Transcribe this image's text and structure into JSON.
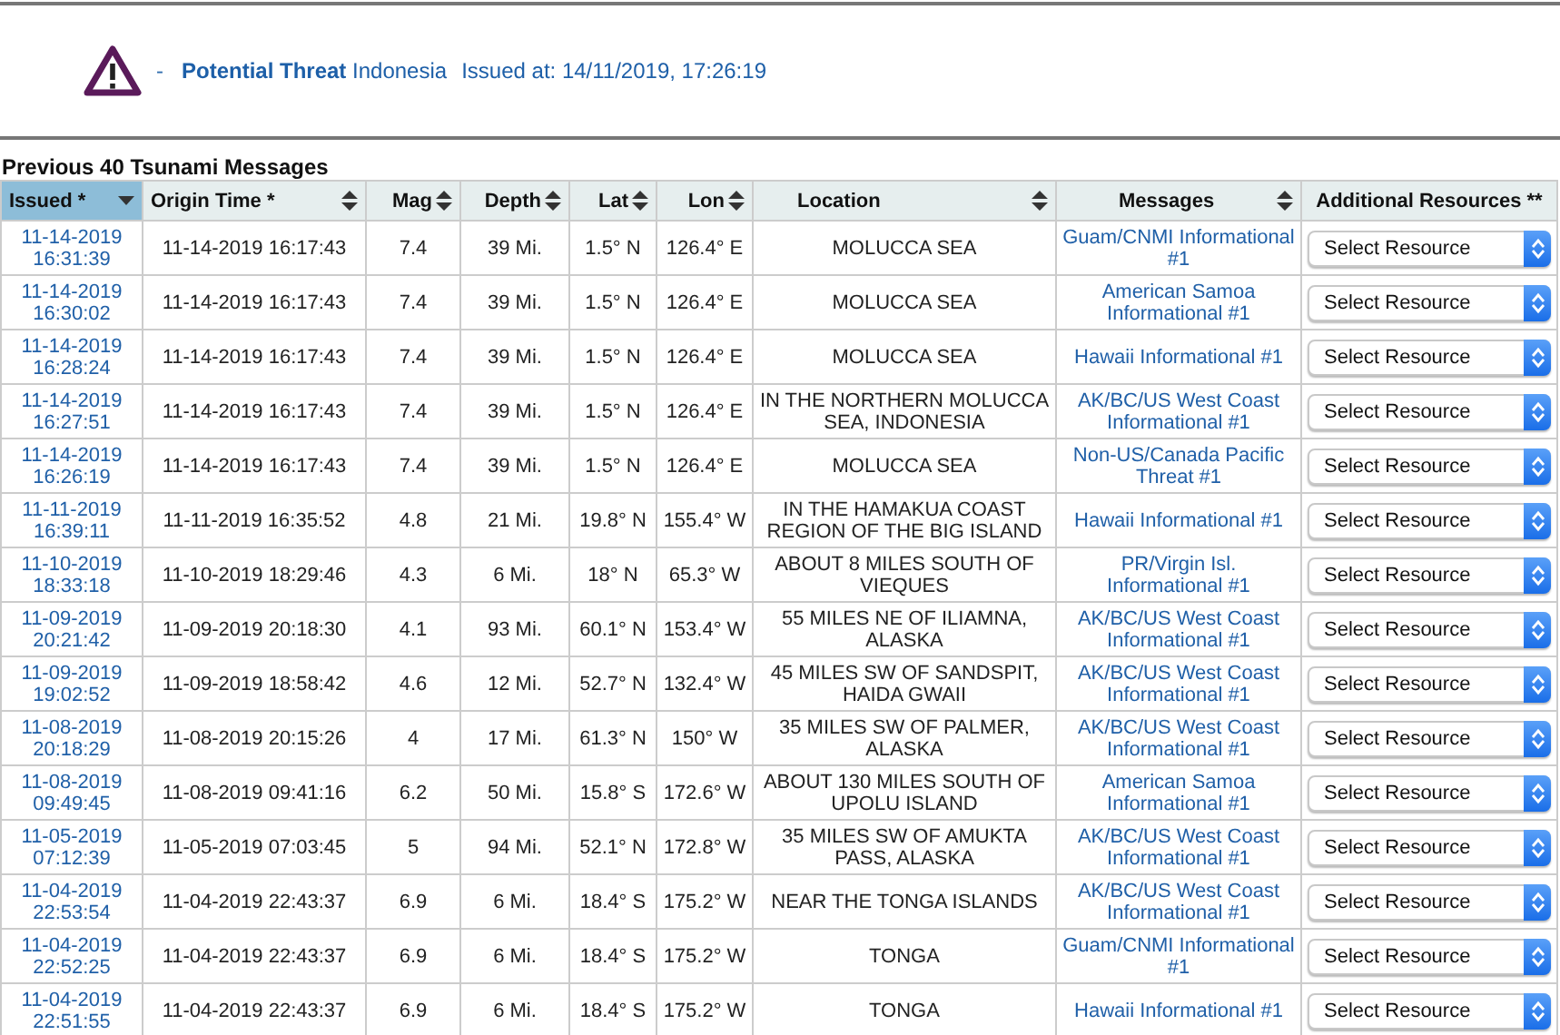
{
  "alert": {
    "separator": "-",
    "level": "Potential Threat",
    "region": "Indonesia",
    "issued": "Issued at: 14/11/2019, 17:26:19"
  },
  "table": {
    "title": "Previous 40 Tsunami Messages",
    "columns": [
      {
        "label": "Issued *",
        "kind": "sorted-desc",
        "selected": true
      },
      {
        "label": "Origin Time *",
        "kind": "sortable",
        "selected": false
      },
      {
        "label": "Mag",
        "kind": "sortable",
        "selected": false
      },
      {
        "label": "Depth",
        "kind": "sortable",
        "selected": false
      },
      {
        "label": "Lat",
        "kind": "sortable",
        "selected": false
      },
      {
        "label": "Lon",
        "kind": "sortable",
        "selected": false
      },
      {
        "label": "Location",
        "kind": "sortable",
        "selected": false
      },
      {
        "label": "Messages",
        "kind": "sortable",
        "selected": false
      },
      {
        "label": "Additional Resources **",
        "kind": "plain",
        "selected": false
      }
    ],
    "rows": [
      {
        "issued": "11-14-2019 16:31:39",
        "origin": "11-14-2019 16:17:43",
        "mag": "7.4",
        "depth": "39 Mi.",
        "lat": "1.5° N",
        "lon": "126.4° E",
        "location": "MOLUCCA SEA",
        "message": "Guam/CNMI Informational #1",
        "resource": "Select Resource"
      },
      {
        "issued": "11-14-2019 16:30:02",
        "origin": "11-14-2019 16:17:43",
        "mag": "7.4",
        "depth": "39 Mi.",
        "lat": "1.5° N",
        "lon": "126.4° E",
        "location": "MOLUCCA SEA",
        "message": "American Samoa Informational #1",
        "resource": "Select Resource"
      },
      {
        "issued": "11-14-2019 16:28:24",
        "origin": "11-14-2019 16:17:43",
        "mag": "7.4",
        "depth": "39 Mi.",
        "lat": "1.5° N",
        "lon": "126.4° E",
        "location": "MOLUCCA SEA",
        "message": "Hawaii Informational #1",
        "resource": "Select Resource"
      },
      {
        "issued": "11-14-2019 16:27:51",
        "origin": "11-14-2019 16:17:43",
        "mag": "7.4",
        "depth": "39 Mi.",
        "lat": "1.5° N",
        "lon": "126.4° E",
        "location": "IN THE NORTHERN MOLUCCA SEA, INDONESIA",
        "message": "AK/BC/US West Coast Informational #1",
        "resource": "Select Resource"
      },
      {
        "issued": "11-14-2019 16:26:19",
        "origin": "11-14-2019 16:17:43",
        "mag": "7.4",
        "depth": "39 Mi.",
        "lat": "1.5° N",
        "lon": "126.4° E",
        "location": "MOLUCCA SEA",
        "message": "Non-US/Canada Pacific Threat #1",
        "resource": "Select Resource"
      },
      {
        "issued": "11-11-2019 16:39:11",
        "origin": "11-11-2019 16:35:52",
        "mag": "4.8",
        "depth": "21 Mi.",
        "lat": "19.8° N",
        "lon": "155.4° W",
        "location": "IN THE HAMAKUA COAST REGION OF THE BIG ISLAND",
        "message": "Hawaii Informational #1",
        "resource": "Select Resource"
      },
      {
        "issued": "11-10-2019 18:33:18",
        "origin": "11-10-2019 18:29:46",
        "mag": "4.3",
        "depth": "6 Mi.",
        "lat": "18° N",
        "lon": "65.3° W",
        "location": "ABOUT 8 MILES SOUTH OF VIEQUES",
        "message": "PR/Virgin Isl. Informational #1",
        "resource": "Select Resource"
      },
      {
        "issued": "11-09-2019 20:21:42",
        "origin": "11-09-2019 20:18:30",
        "mag": "4.1",
        "depth": "93 Mi.",
        "lat": "60.1° N",
        "lon": "153.4° W",
        "location": "55 MILES NE OF ILIAMNA, ALASKA",
        "message": "AK/BC/US West Coast Informational #1",
        "resource": "Select Resource"
      },
      {
        "issued": "11-09-2019 19:02:52",
        "origin": "11-09-2019 18:58:42",
        "mag": "4.6",
        "depth": "12 Mi.",
        "lat": "52.7° N",
        "lon": "132.4° W",
        "location": "45 MILES SW OF SANDSPIT, HAIDA GWAII",
        "message": "AK/BC/US West Coast Informational #1",
        "resource": "Select Resource"
      },
      {
        "issued": "11-08-2019 20:18:29",
        "origin": "11-08-2019 20:15:26",
        "mag": "4",
        "depth": "17 Mi.",
        "lat": "61.3° N",
        "lon": "150° W",
        "location": "35 MILES SW OF PALMER, ALASKA",
        "message": "AK/BC/US West Coast Informational #1",
        "resource": "Select Resource"
      },
      {
        "issued": "11-08-2019 09:49:45",
        "origin": "11-08-2019 09:41:16",
        "mag": "6.2",
        "depth": "50 Mi.",
        "lat": "15.8° S",
        "lon": "172.6° W",
        "location": "ABOUT 130 MILES SOUTH OF UPOLU ISLAND",
        "message": "American Samoa Informational #1",
        "resource": "Select Resource"
      },
      {
        "issued": "11-05-2019 07:12:39",
        "origin": "11-05-2019 07:03:45",
        "mag": "5",
        "depth": "94 Mi.",
        "lat": "52.1° N",
        "lon": "172.8° W",
        "location": "35 MILES SW OF AMUKTA PASS, ALASKA",
        "message": "AK/BC/US West Coast Informational #1",
        "resource": "Select Resource"
      },
      {
        "issued": "11-04-2019 22:53:54",
        "origin": "11-04-2019 22:43:37",
        "mag": "6.9",
        "depth": "6 Mi.",
        "lat": "18.4° S",
        "lon": "175.2° W",
        "location": "NEAR THE TONGA ISLANDS",
        "message": "AK/BC/US West Coast Informational #1",
        "resource": "Select Resource"
      },
      {
        "issued": "11-04-2019 22:52:25",
        "origin": "11-04-2019 22:43:37",
        "mag": "6.9",
        "depth": "6 Mi.",
        "lat": "18.4° S",
        "lon": "175.2° W",
        "location": "TONGA",
        "message": "Guam/CNMI Informational #1",
        "resource": "Select Resource"
      },
      {
        "issued": "11-04-2019 22:51:55",
        "origin": "11-04-2019 22:43:37",
        "mag": "6.9",
        "depth": "6 Mi.",
        "lat": "18.4° S",
        "lon": "175.2° W",
        "location": "TONGA",
        "message": "Hawaii Informational #1",
        "resource": "Select Resource"
      }
    ]
  }
}
